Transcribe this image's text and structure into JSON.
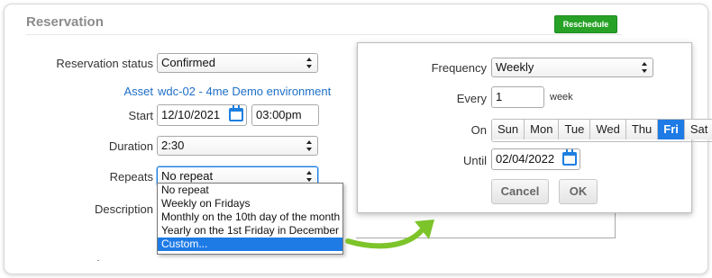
{
  "section": {
    "title": "Reservation",
    "reschedule_label": "Reschedule"
  },
  "form": {
    "status_label": "Reservation status",
    "status_value": "Confirmed",
    "asset_label": "Asset",
    "asset_value": "wdc-02 - 4me Demo environment",
    "start_label": "Start",
    "start_date": "12/10/2021",
    "start_time": "03:00pm",
    "duration_label": "Duration",
    "duration_value": "2:30",
    "repeats_label": "Repeats",
    "repeats_value": "No repeat",
    "description_label": "Description"
  },
  "repeat_options": [
    {
      "label": "No repeat",
      "selected": false
    },
    {
      "label": "Weekly on Fridays",
      "selected": false
    },
    {
      "label": "Monthly on the 10th day of the month",
      "selected": false
    },
    {
      "label": "Yearly on the 1st Friday in December",
      "selected": false
    },
    {
      "label": "Custom...",
      "selected": true
    }
  ],
  "custom": {
    "frequency_label": "Frequency",
    "frequency_value": "Weekly",
    "every_label": "Every",
    "every_value": "1",
    "every_unit": "week",
    "on_label": "On",
    "days": [
      {
        "label": "Sun",
        "active": false
      },
      {
        "label": "Mon",
        "active": false
      },
      {
        "label": "Tue",
        "active": false
      },
      {
        "label": "Wed",
        "active": false
      },
      {
        "label": "Thu",
        "active": false
      },
      {
        "label": "Fri",
        "active": true
      },
      {
        "label": "Sat",
        "active": false
      }
    ],
    "until_label": "Until",
    "until_value": "02/04/2022",
    "cancel_label": "Cancel",
    "ok_label": "OK"
  },
  "colors": {
    "accent": "#1e7be6",
    "reschedule_green": "#27a227",
    "arrow_green": "#7cc42a",
    "link_blue": "#1d6fc7"
  },
  "icons": {
    "calendar": "calendar-icon",
    "select_arrows": "updown-arrows-icon",
    "arrow": "curved-arrow-icon"
  }
}
